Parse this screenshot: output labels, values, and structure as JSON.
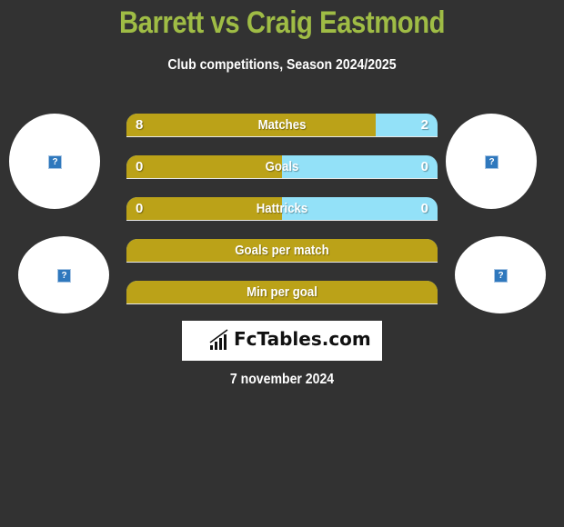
{
  "header": {
    "title": "Barrett vs Craig Eastmond",
    "subtitle": "Club competitions, Season 2024/2025"
  },
  "players": {
    "left": {
      "avatar_icon": "missing-image-icon",
      "club_icon": "missing-image-icon"
    },
    "right": {
      "avatar_icon": "missing-image-icon",
      "club_icon": "missing-image-icon"
    }
  },
  "stats": [
    {
      "label": "Matches",
      "left": "8",
      "right": "2",
      "left_share": 0.8
    },
    {
      "label": "Goals",
      "left": "0",
      "right": "0",
      "left_share": 0.5
    },
    {
      "label": "Hattricks",
      "left": "0",
      "right": "0",
      "left_share": 0.5
    },
    {
      "label": "Goals per match",
      "left": "",
      "right": "",
      "left_share": 1.0
    },
    {
      "label": "Min per goal",
      "left": "",
      "right": "",
      "left_share": 1.0
    }
  ],
  "colors": {
    "title": "#9fbc45",
    "left_bar": "#bba218",
    "right_bar": "#93e1f8",
    "background": "#323232"
  },
  "logo": {
    "text": "FcTables.com",
    "icon": "bar-chart-icon"
  },
  "footer": {
    "date": "7 november 2024"
  }
}
